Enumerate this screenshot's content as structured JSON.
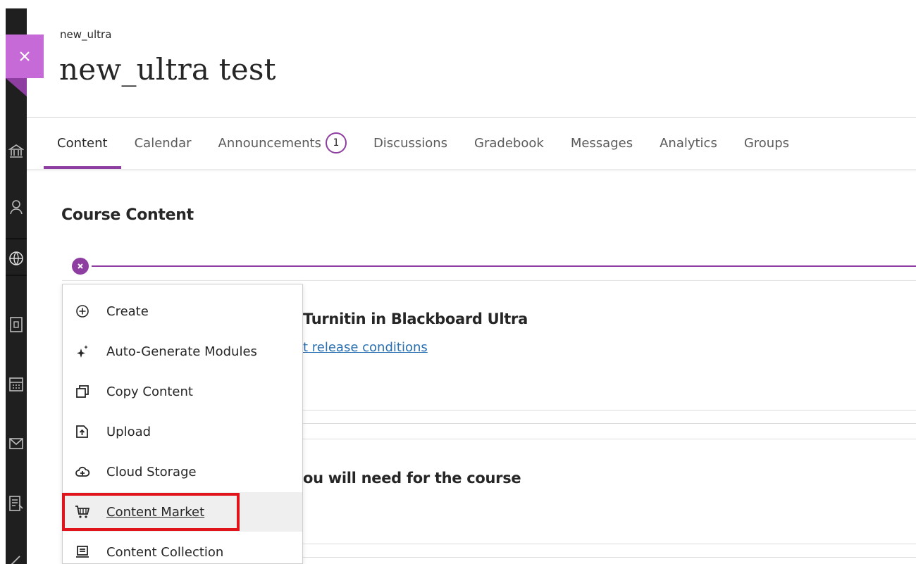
{
  "course": {
    "short_name": "new_ultra",
    "title": "new_ultra test"
  },
  "nav": {
    "tabs": [
      {
        "label": "Content"
      },
      {
        "label": "Calendar"
      },
      {
        "label": "Announcements",
        "badge": "1"
      },
      {
        "label": "Discussions"
      },
      {
        "label": "Gradebook"
      },
      {
        "label": "Messages"
      },
      {
        "label": "Analytics"
      },
      {
        "label": "Groups"
      }
    ]
  },
  "content": {
    "section_title": "Course Content",
    "items": [
      {
        "title": "Turnitin in Blackboard Ultra",
        "link": "t release conditions"
      },
      {
        "title": "ou will need for the course"
      }
    ]
  },
  "menu": {
    "items": [
      {
        "label": "Create",
        "icon": "plus-circle-icon"
      },
      {
        "label": "Auto-Generate Modules",
        "icon": "sparkle-icon"
      },
      {
        "label": "Copy Content",
        "icon": "copy-icon"
      },
      {
        "label": "Upload",
        "icon": "upload-icon"
      },
      {
        "label": "Cloud Storage",
        "icon": "cloud-storage-icon"
      },
      {
        "label": "Content Market",
        "icon": "cart-icon"
      },
      {
        "label": "Content Collection",
        "icon": "collection-icon"
      }
    ]
  },
  "colors": {
    "accent": "#8e3ea0",
    "close_tab": "#c56ad6",
    "highlight": "#e0141b",
    "link": "#2a6fb0"
  }
}
